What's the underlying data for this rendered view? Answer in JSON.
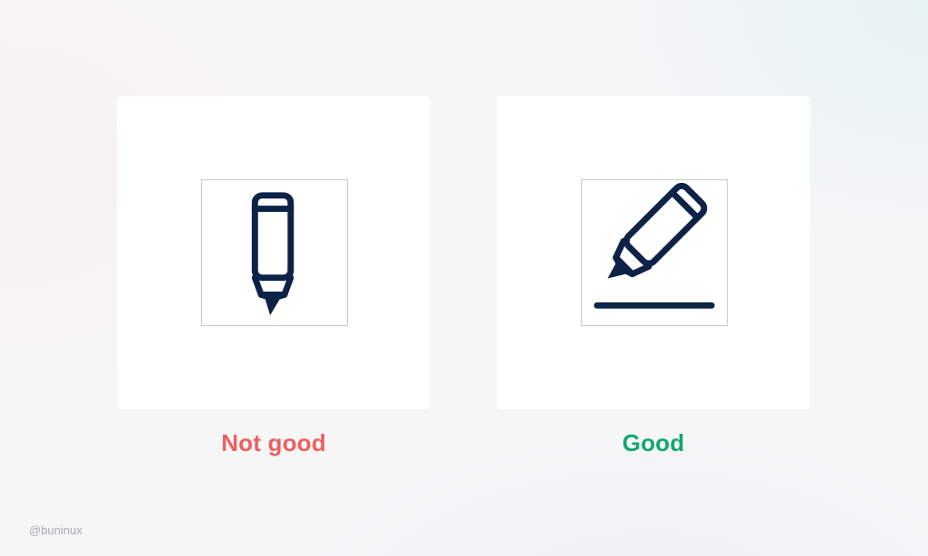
{
  "colors": {
    "icon_stroke": "#0d2247",
    "bad_label": "#f05e5e",
    "good_label": "#14a672",
    "frame_border": "#c9c9cc",
    "credit_text": "#a8abb2"
  },
  "examples": [
    {
      "label": "Not good",
      "icon": "pencil-vertical-icon",
      "verdict": "bad"
    },
    {
      "label": "Good",
      "icon": "pencil-writing-line-icon",
      "verdict": "good"
    }
  ],
  "credit": "@buninux"
}
